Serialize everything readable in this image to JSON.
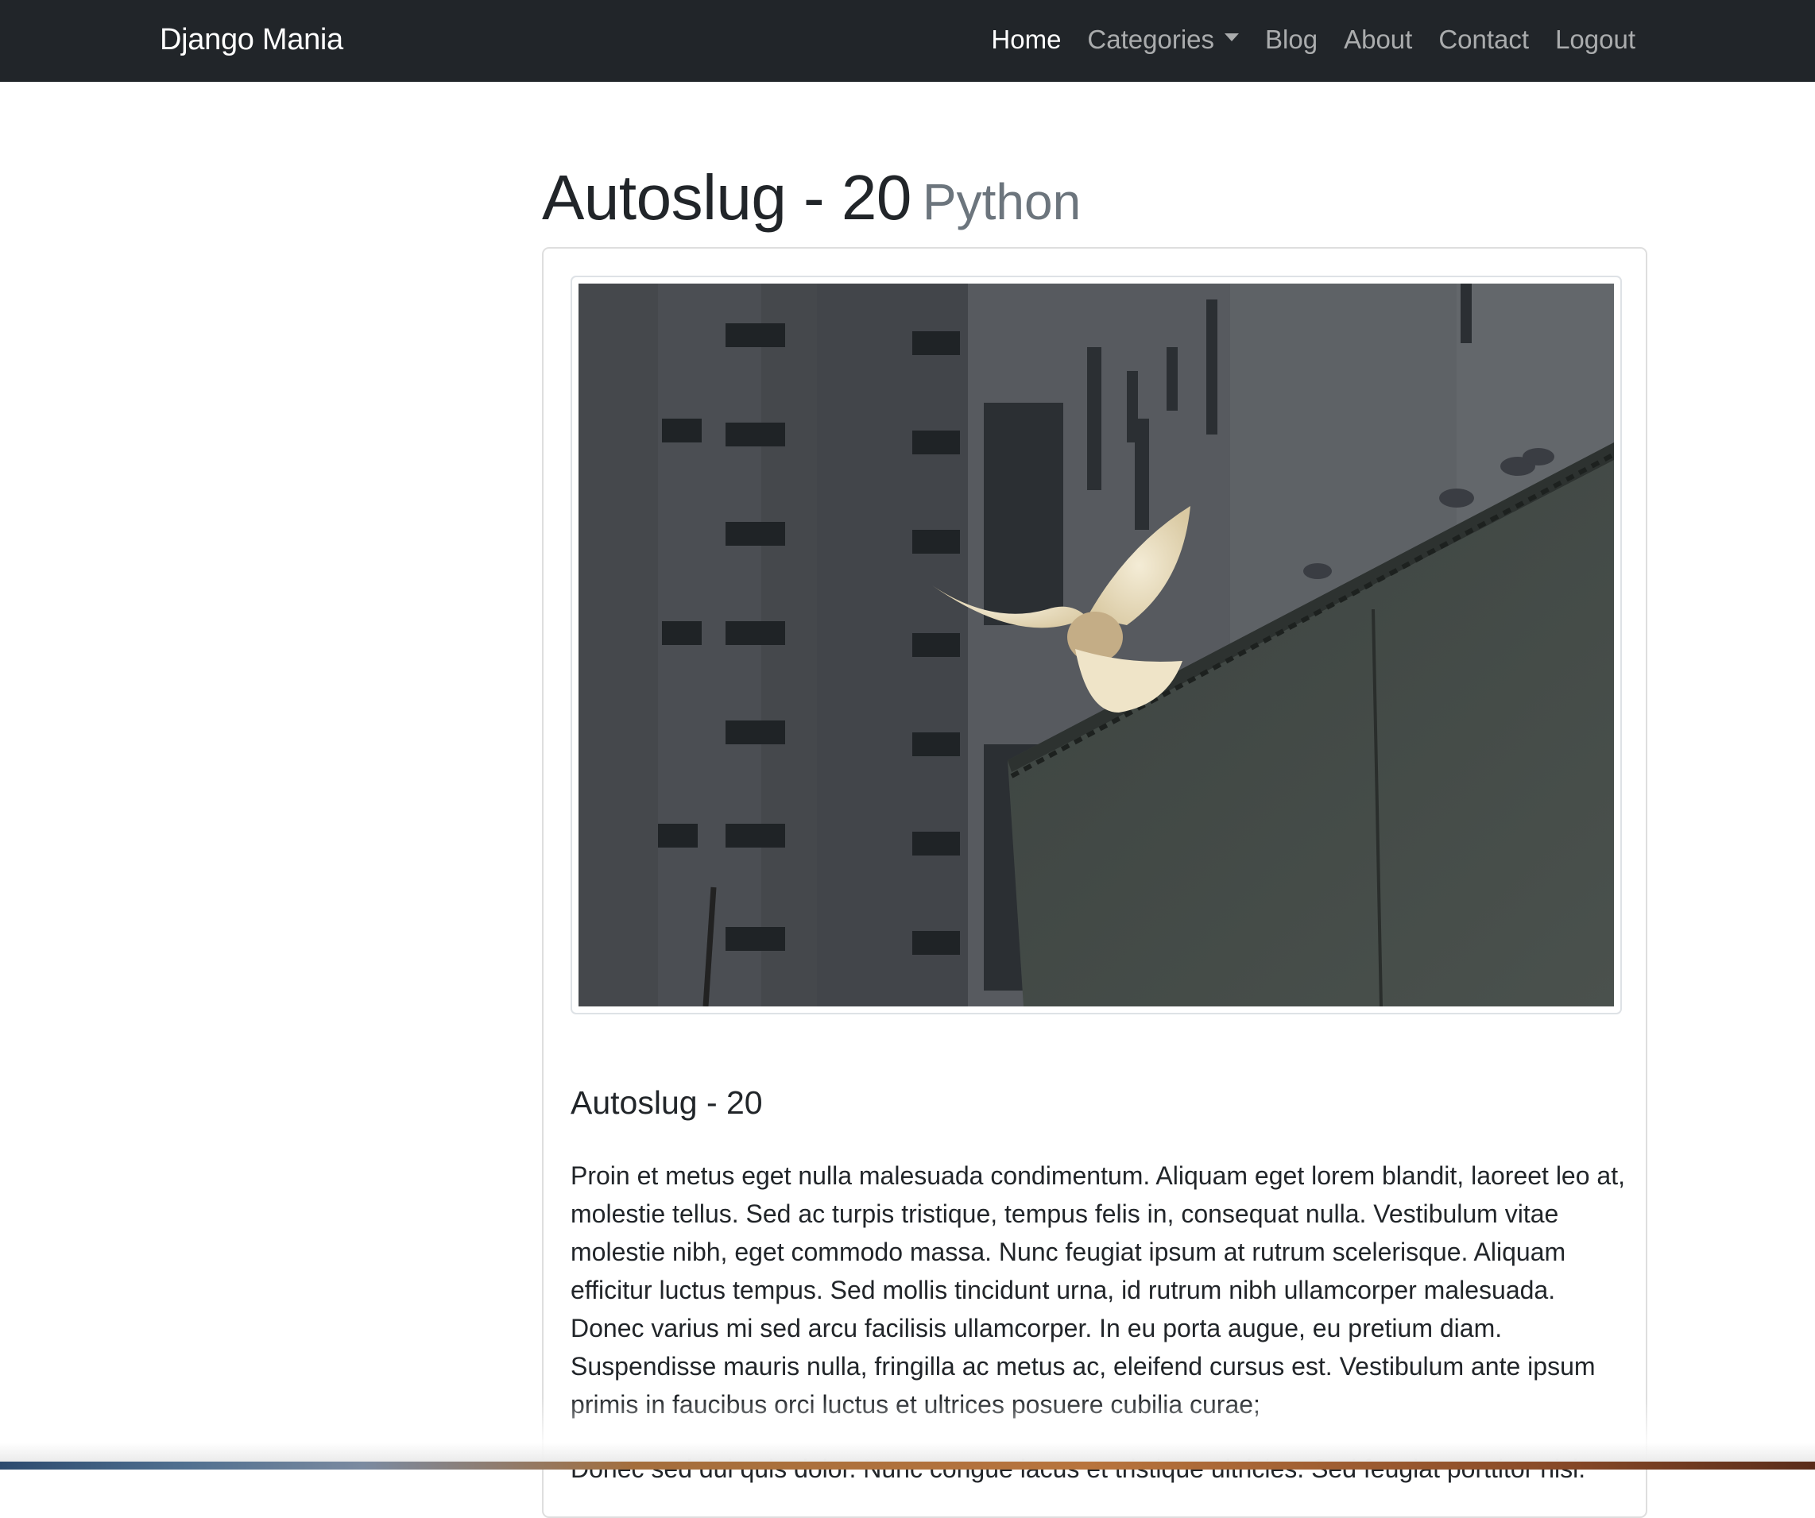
{
  "navbar": {
    "brand": "Django Mania",
    "items": [
      {
        "label": "Home",
        "active": true
      },
      {
        "label": "Categories",
        "dropdown": true
      },
      {
        "label": "Blog"
      },
      {
        "label": "About"
      },
      {
        "label": "Contact"
      },
      {
        "label": "Logout"
      }
    ]
  },
  "page": {
    "title": "Autoslug - 20",
    "category": "Python"
  },
  "post": {
    "title": "Autoslug - 20",
    "paragraphs": [
      "Proin et metus eget nulla malesuada condimentum. Aliquam eget lorem blandit, laoreet leo at, molestie tellus. Sed ac turpis tristique, tempus felis in, consequat nulla. Vestibulum vitae molestie nibh, eget commodo massa. Nunc feugiat ipsum at rutrum scelerisque. Aliquam efficitur luctus tempus. Sed mollis tincidunt urna, id rutrum nibh ullamcorper malesuada. Donec varius mi sed arcu facilisis ullamcorper. In eu porta augue, eu pretium diam. Suspendisse mauris nulla, fringilla ac metus ac, eleifend cursus est. Vestibulum ante ipsum primis in faucibus orci luctus et ultrices posuere cubilia curae;",
      "Donec sed dui quis dolor. Nunc congue lacus et tristique ultricies. Sed feugiat porttitor nisl."
    ]
  },
  "colors": {
    "navbar_bg": "#212529",
    "text": "#212529",
    "muted": "#6c757d"
  }
}
